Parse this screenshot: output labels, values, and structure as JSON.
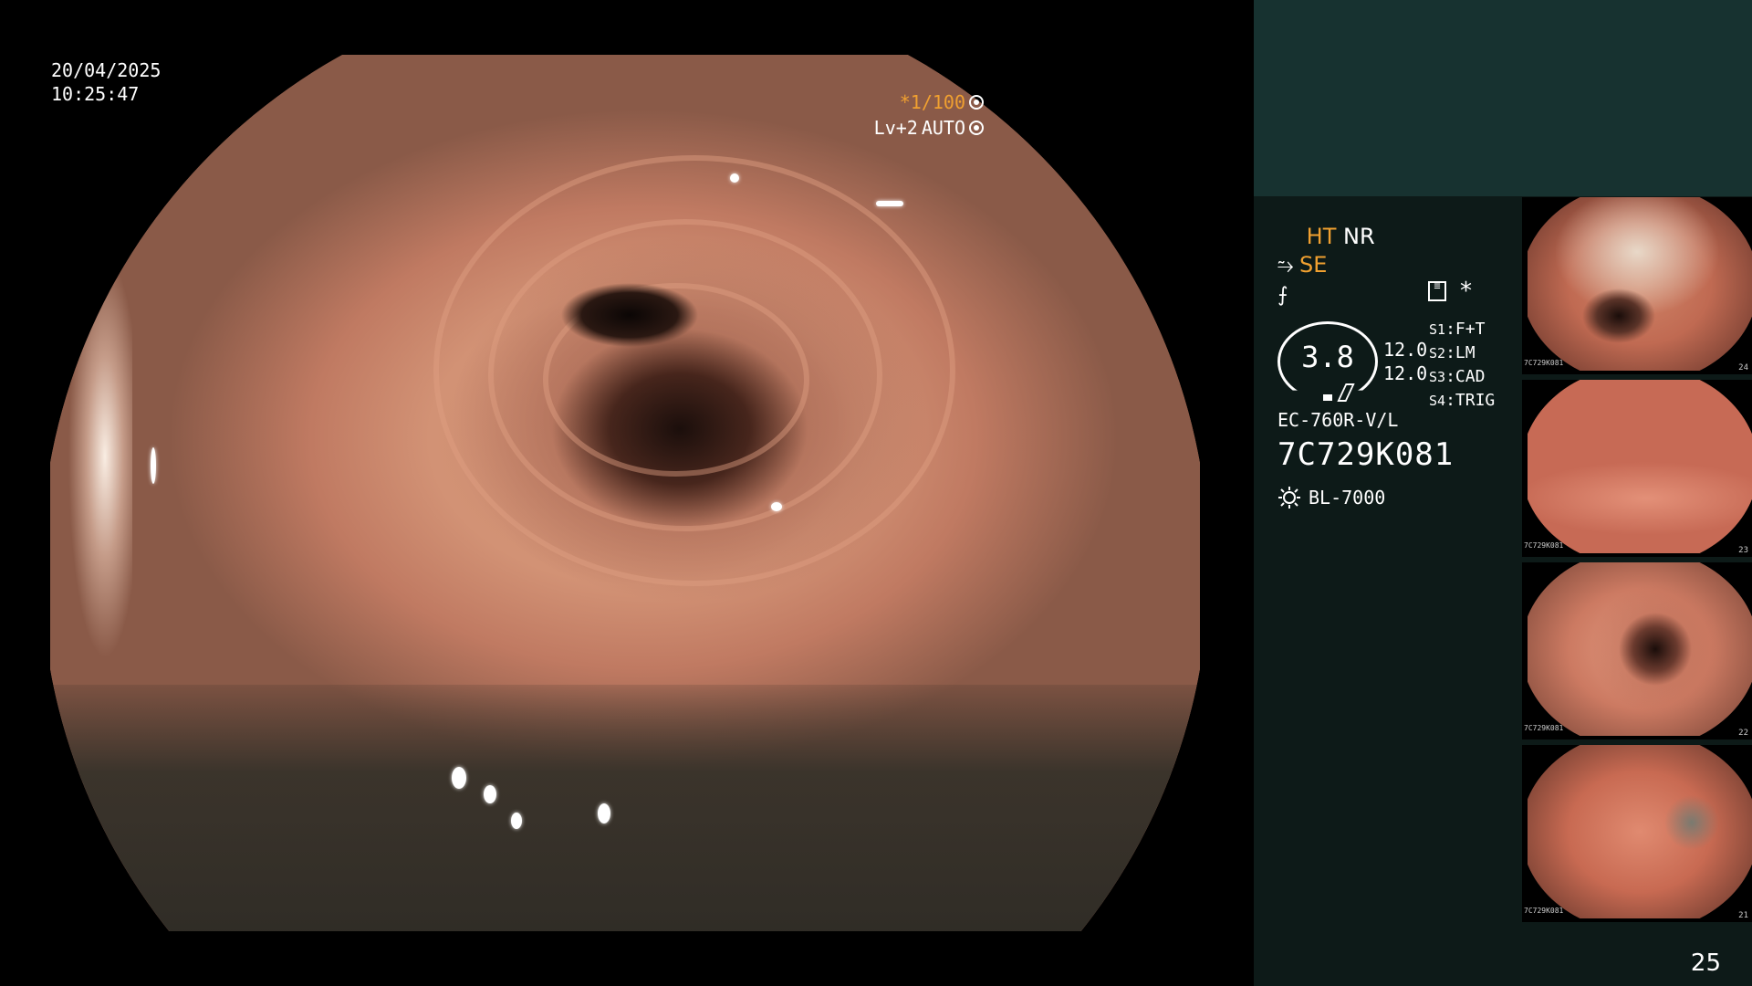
{
  "datetime": {
    "date": "20/04/2025",
    "time": "10:25:47"
  },
  "exposure": {
    "shutter": "*1/100",
    "level": "Lv+2",
    "mode": "AUTO"
  },
  "status": {
    "ht": "HT",
    "nr": "NR",
    "se": "SE",
    "se_symbol": "⥲",
    "f_symbol": "⨍",
    "asterisk": "*"
  },
  "gauge": {
    "value": "3.8",
    "upper": "12.0",
    "lower": "12.0"
  },
  "switches": [
    {
      "key": "S1",
      "value": "F+T"
    },
    {
      "key": "S2",
      "value": "LM"
    },
    {
      "key": "S3",
      "value": "CAD"
    },
    {
      "key": "S4",
      "value": "TRIG"
    }
  ],
  "scope": {
    "model": "EC-760R-V/L",
    "serial": "7C729K081",
    "light_source": "BL-7000"
  },
  "thumbnails": [
    {
      "number": "24",
      "serial": "7C729K081"
    },
    {
      "number": "23",
      "serial": "7C729K081"
    },
    {
      "number": "22",
      "serial": "7C729K081"
    },
    {
      "number": "21",
      "serial": "7C729K081"
    }
  ],
  "page_number": "25",
  "colors": {
    "accent_orange": "#f0a030",
    "panel_top": "#173230",
    "panel": "#0d1a18"
  }
}
